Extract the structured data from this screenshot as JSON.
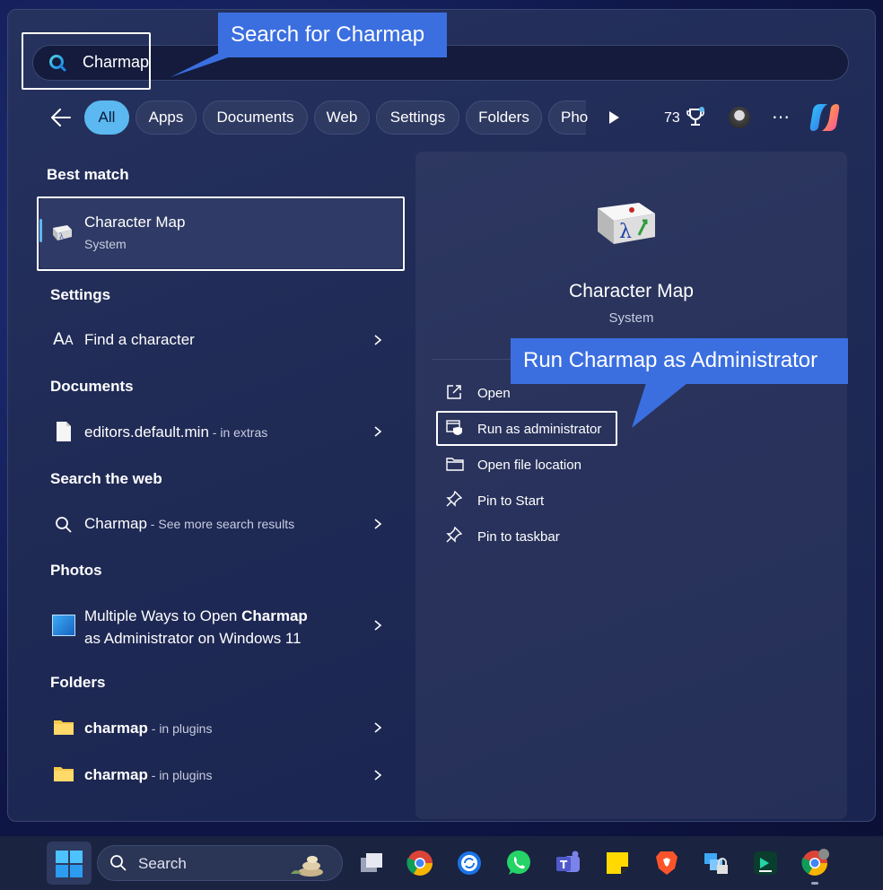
{
  "search": {
    "query": "Charmap"
  },
  "callouts": {
    "search": "Search for Charmap",
    "run_admin": "Run Charmap as Administrator"
  },
  "tabs": [
    {
      "label": "All",
      "active": true
    },
    {
      "label": "Apps"
    },
    {
      "label": "Documents"
    },
    {
      "label": "Web"
    },
    {
      "label": "Settings"
    },
    {
      "label": "Folders"
    },
    {
      "label": "Pho"
    }
  ],
  "header_right": {
    "points": "73"
  },
  "best_match": {
    "heading": "Best match",
    "title": "Character Map",
    "subtitle": "System"
  },
  "settings": {
    "heading": "Settings",
    "item": "Find a character"
  },
  "documents": {
    "heading": "Documents",
    "item_name": "editors.default.min",
    "item_loc": " - in extras"
  },
  "web": {
    "heading": "Search the web",
    "item_name": "Charmap",
    "item_hint": " - See more search results"
  },
  "photos": {
    "heading": "Photos",
    "line1_pre": "Multiple Ways to Open ",
    "line1_bold": "Charmap",
    "line2": "as Administrator on Windows 11"
  },
  "folders": {
    "heading": "Folders",
    "items": [
      {
        "name": "charmap",
        "loc": " - in plugins"
      },
      {
        "name": "charmap",
        "loc": " - in plugins"
      }
    ]
  },
  "detail": {
    "title": "Character Map",
    "subtitle": "System",
    "icon_glyph": "λ",
    "actions": [
      {
        "label": "Open",
        "icon": "open-external-icon"
      },
      {
        "label": "Run as administrator",
        "icon": "shield-admin-icon"
      },
      {
        "label": "Open file location",
        "icon": "folder-icon"
      },
      {
        "label": "Pin to Start",
        "icon": "pin-icon"
      },
      {
        "label": "Pin to taskbar",
        "icon": "pin-icon"
      }
    ]
  },
  "taskbar": {
    "search_placeholder": "Search",
    "apps": [
      "windows-start",
      "task-view",
      "chrome",
      "app-sync",
      "whatsapp",
      "teams",
      "sticky-notes",
      "brave",
      "network-lock",
      "filmora",
      "chrome-profile"
    ]
  },
  "colors": {
    "accent": "#5bb8f0",
    "callout": "#3b6fe0",
    "panel": "#1f2a55"
  }
}
